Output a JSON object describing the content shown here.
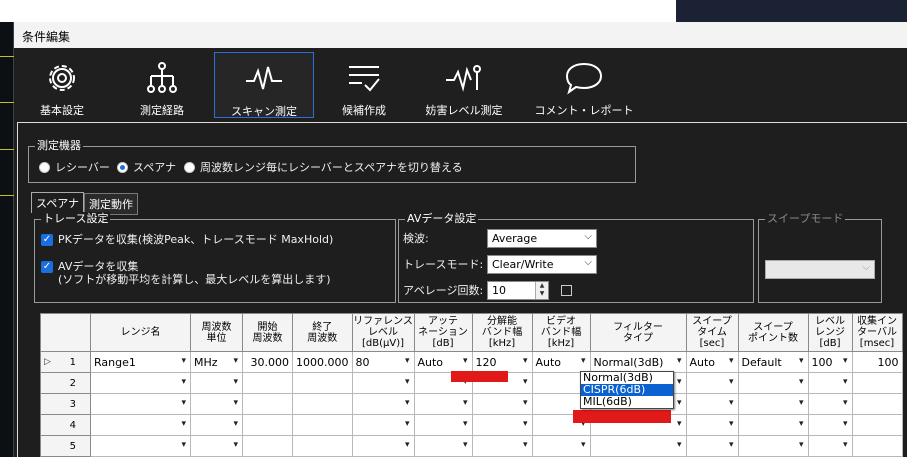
{
  "window": {
    "title": "条件編集"
  },
  "ribbon": [
    {
      "label": "基本設定",
      "icon": "gear-icon"
    },
    {
      "label": "測定経路",
      "icon": "hierarchy-icon"
    },
    {
      "label": "スキャン測定",
      "icon": "waveform-icon"
    },
    {
      "label": "候補作成",
      "icon": "checklist-icon"
    },
    {
      "label": "妨害レベル測定",
      "icon": "pulse-icon"
    },
    {
      "label": "コメント・レポート",
      "icon": "speech-bubble-icon"
    }
  ],
  "instrument": {
    "title": "測定機器",
    "options": [
      "レシーバー",
      "スペアナ",
      "周波数レンジ毎にレシーバーとスペアナを切り替える"
    ],
    "selected": "スペアナ"
  },
  "tabs": [
    "スペアナ",
    "測定動作"
  ],
  "trace": {
    "title": "トレース設定",
    "pk": "PKデータを収集(検波Peak、トレースモード MaxHold)",
    "av1": "AVデータを収集",
    "av2": "(ソフトが移動平均を計算し、最大レベルを算出します)"
  },
  "av": {
    "title": "AVデータ設定",
    "detect_label": "検波:",
    "detect_value": "Average",
    "mode_label": "トレースモード:",
    "mode_value": "Clear/Write",
    "count_label": "アベレージ回数:",
    "count_value": "10"
  },
  "sweep": {
    "title": "スイープモード"
  },
  "grid": {
    "headers": [
      "",
      "レンジ名",
      "周波数\n単位",
      "開始\n周波数",
      "終了\n周波数",
      "リファレンス\nレベル\n[dB(μV)]",
      "アッテ\nネーション\n[dB]",
      "分解能\nバンド幅\n[kHz]",
      "ビデオ\nバンド幅\n[kHz]",
      "フィルター\nタイプ",
      "スイープ\nタイム\n[sec]",
      "スイープ\nポイント数",
      "レベル\nレンジ\n[dB]",
      "収集イン\nターバル\n[msec]"
    ],
    "row1": [
      "1",
      "Range1",
      "MHz",
      "30.000",
      "1000.000",
      "80",
      "Auto",
      "120",
      "Auto",
      "Normal(3dB)",
      "Auto",
      "Default",
      "100",
      "100"
    ],
    "rows": [
      "2",
      "3",
      "4",
      "5"
    ]
  },
  "filter_dropdown": {
    "options": [
      "Normal(3dB)",
      "CISPR(6dB)",
      "MIL(6dB)"
    ],
    "highlighted": "CISPR(6dB)"
  }
}
